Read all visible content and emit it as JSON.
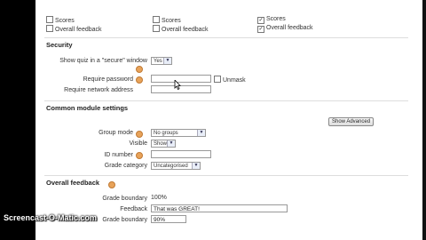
{
  "review_options": {
    "columns": [
      {
        "items": [
          {
            "label": "Scores",
            "checked": false
          },
          {
            "label": "Overall feedback",
            "checked": false
          }
        ]
      },
      {
        "items": [
          {
            "label": "Scores",
            "checked": false
          },
          {
            "label": "Overall feedback",
            "checked": false
          }
        ]
      },
      {
        "items": [
          {
            "label": "Scores",
            "checked": true
          },
          {
            "label": "Overall feedback",
            "checked": true
          }
        ]
      }
    ]
  },
  "security": {
    "title": "Security",
    "secure_window_label": "Show quiz in a \"secure\" window",
    "secure_window_value": "Yes",
    "password_label": "Require password",
    "password_value": "",
    "unmask_label": "Unmask",
    "network_label": "Require network address",
    "network_value": ""
  },
  "common_module": {
    "title": "Common module settings",
    "show_advanced_label": "Show Advanced",
    "group_mode_label": "Group mode",
    "group_mode_value": "No groups",
    "visible_label": "Visible",
    "visible_value": "Show",
    "id_number_label": "ID number",
    "id_number_value": "",
    "grade_category_label": "Grade category",
    "grade_category_value": "Uncategorised"
  },
  "overall_feedback": {
    "title": "Overall feedback",
    "grade_boundary_label": "Grade boundary",
    "grade_boundary_top": "100%",
    "feedback_label": "Feedback",
    "feedback_value": "That was GREAT!",
    "grade_boundary_2_label": "Grade boundary",
    "grade_boundary_2_value": "90%"
  },
  "watermark": "Screencast-O-Matic.com",
  "colors": {
    "help_icon": "#e8a35a",
    "background": "#ffffff",
    "letterbox": "#000000"
  }
}
